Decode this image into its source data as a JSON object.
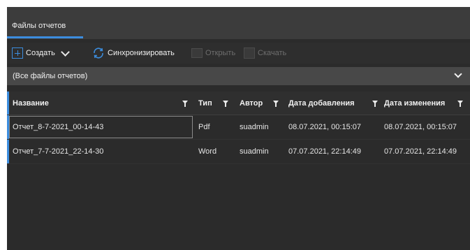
{
  "tabs": [
    {
      "label": "Файлы отчетов",
      "active": true
    }
  ],
  "toolbar": {
    "create_label": "Создать",
    "sync_label": "Синхронизировать",
    "open_label": "Открыть",
    "download_label": "Скачать"
  },
  "filter": {
    "selected": "(Все файлы отчетов)"
  },
  "table": {
    "columns": [
      "Название",
      "Тип",
      "Автор",
      "Дата добавления",
      "Дата изменения"
    ],
    "rows": [
      {
        "name": "Отчет_8-7-2021_00-14-43",
        "type": "Pdf",
        "author": "suadmin",
        "added": "08.07.2021, 00:15:07",
        "modified": "08.07.2021, 00:15:07"
      },
      {
        "name": "Отчет_7-7-2021_22-14-30",
        "type": "Word",
        "author": "suadmin",
        "added": "07.07.2021, 22:14:49",
        "modified": "07.07.2021, 22:14:49"
      }
    ]
  },
  "colors": {
    "accent": "#3c8dde",
    "background": "#2b2b2b",
    "tabbar": "#3c3c3c",
    "filterbar": "#484848"
  }
}
